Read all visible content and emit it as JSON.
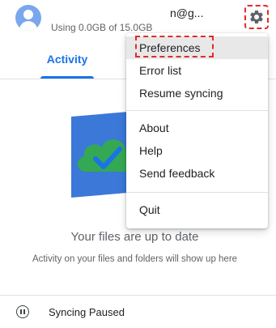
{
  "header": {
    "email_fragment": "n@g...",
    "storage_text": "Using 0.0GB of 15.0GB"
  },
  "tabs": [
    {
      "label": "Activity",
      "active": true
    }
  ],
  "main": {
    "title": "Your files are up to date",
    "subtitle": "Activity on your files and folders will show up here"
  },
  "status": {
    "label": "Syncing Paused",
    "icon": "pause-circle-icon"
  },
  "menu": {
    "items": [
      {
        "label": "Preferences",
        "highlighted": true
      },
      {
        "label": "Error list"
      },
      {
        "label": "Resume syncing"
      },
      {
        "label": "About"
      },
      {
        "label": "Help"
      },
      {
        "label": "Send feedback"
      },
      {
        "label": "Quit"
      }
    ]
  },
  "colors": {
    "accent": "#1a73e8",
    "annotation": "#e32b2b",
    "avatar": "#7aa7ec"
  }
}
